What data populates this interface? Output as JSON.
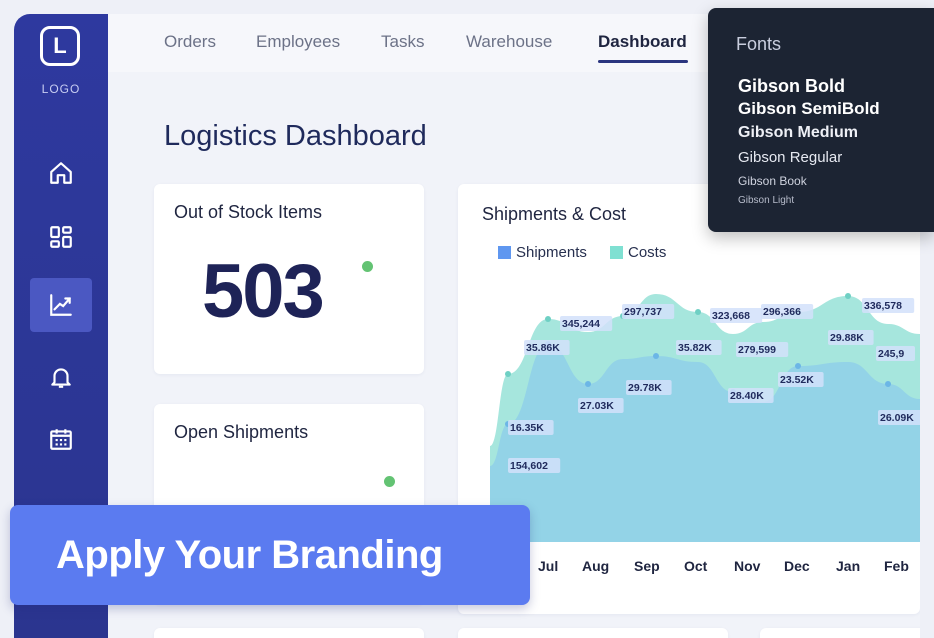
{
  "sidebar": {
    "logo_letter": "L",
    "logo_label": "LOGO",
    "items": [
      {
        "icon": "home-icon"
      },
      {
        "icon": "dashboard-grid-icon"
      },
      {
        "icon": "chart-icon",
        "active": true
      },
      {
        "icon": "bell-icon"
      },
      {
        "icon": "calendar-icon"
      }
    ]
  },
  "nav": {
    "tabs": [
      "Orders",
      "Employees",
      "Tasks",
      "Warehouse",
      "Dashboard"
    ],
    "active": "Dashboard"
  },
  "page": {
    "title": "Logistics Dashboard"
  },
  "cards": {
    "out_of_stock": {
      "title": "Out of Stock Items",
      "value": "503"
    },
    "open_shipments": {
      "title": "Open Shipments"
    }
  },
  "chart_data": {
    "type": "area",
    "title": "Shipments & Cost",
    "categories": [
      "Jul",
      "Aug",
      "Sep",
      "Oct",
      "Nov",
      "Dec",
      "Jan",
      "Feb"
    ],
    "series": [
      {
        "name": "Shipments",
        "color": "#8fd1e6",
        "labels": [
          "16.35K",
          "35.86K",
          "27.03K",
          "29.78K",
          "35.82K",
          "28.40K",
          "23.52K",
          "29.88K",
          "26.09K"
        ]
      },
      {
        "name": "Costs",
        "color": "#9fe3db",
        "labels": [
          "154,602",
          "345,244",
          "297,737",
          "323,668",
          "279,599",
          "296,366",
          "336,578",
          "245,9"
        ]
      }
    ]
  },
  "fonts_panel": {
    "heading": "Fonts",
    "fonts": [
      "Gibson Bold",
      "Gibson SemiBold",
      "Gibson Medium",
      "Gibson Regular",
      "Gibson Book",
      "Gibson Light"
    ]
  },
  "banner": {
    "text": "Apply Your Branding"
  },
  "colors": {
    "sidebar": "#2e399f",
    "banner": "#5b7bf0",
    "accent_green": "#63c373"
  }
}
